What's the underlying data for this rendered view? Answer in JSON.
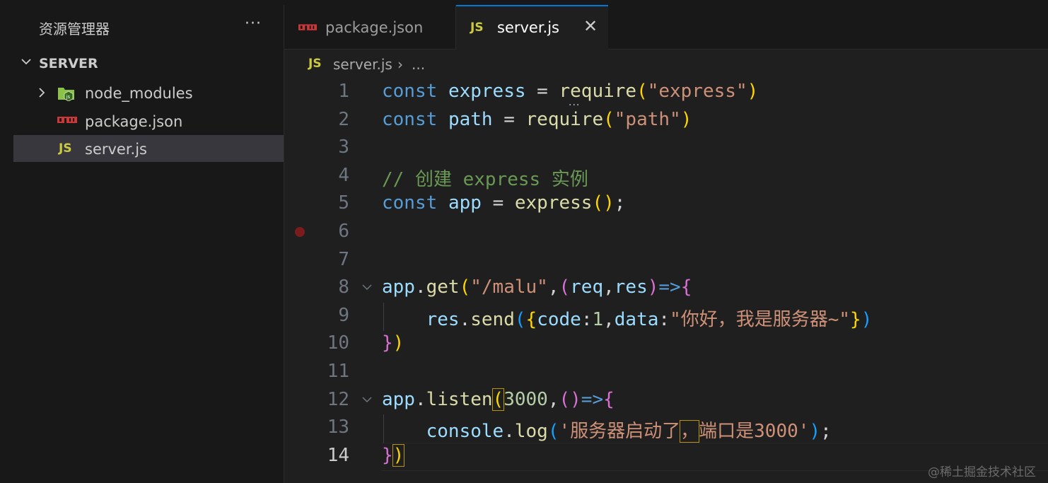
{
  "sidebar": {
    "title": "资源管理器",
    "more_label": "···",
    "section": "SERVER",
    "items": [
      {
        "label": "node_modules",
        "icon": "nodejs-folder-icon"
      },
      {
        "label": "package.json",
        "icon": "npm-icon"
      },
      {
        "label": "server.js",
        "icon": "js-icon",
        "badge": "JS"
      }
    ]
  },
  "tabs": [
    {
      "label": "package.json",
      "icon": "npm-icon",
      "active": false
    },
    {
      "label": "server.js",
      "icon": "js-icon",
      "badge": "JS",
      "active": true,
      "close": "✕"
    }
  ],
  "breadcrumb": {
    "badge": "JS",
    "file": "server.js",
    "sep": "›",
    "more": "..."
  },
  "editor": {
    "line_numbers": [
      "1",
      "2",
      "3",
      "4",
      "5",
      "6",
      "7",
      "8",
      "9",
      "10",
      "11",
      "12",
      "13",
      "14"
    ],
    "current_line": "14",
    "lines": [
      "const express = require(\"express\")",
      "const path = require(\"path\")",
      "",
      "// 创建 express 实例",
      "const app = express();",
      "",
      "",
      "app.get(\"/malu\",(req,res)=>{",
      "    res.send({code:1,data:\"你好，我是服务器~\"})",
      "})",
      "",
      "app.listen(3000,()=>{",
      "    console.log('服务器启动了，端口是3000');",
      "})"
    ],
    "ellipsis": "···"
  },
  "colors": {
    "keyword": "#569cd6",
    "variable": "#9cdcfe",
    "function": "#dcdcaa",
    "string": "#ce9178",
    "comment": "#6a9955",
    "number": "#b5cea8",
    "accent": "#0078d4"
  },
  "watermark": "@稀土掘金技术社区"
}
